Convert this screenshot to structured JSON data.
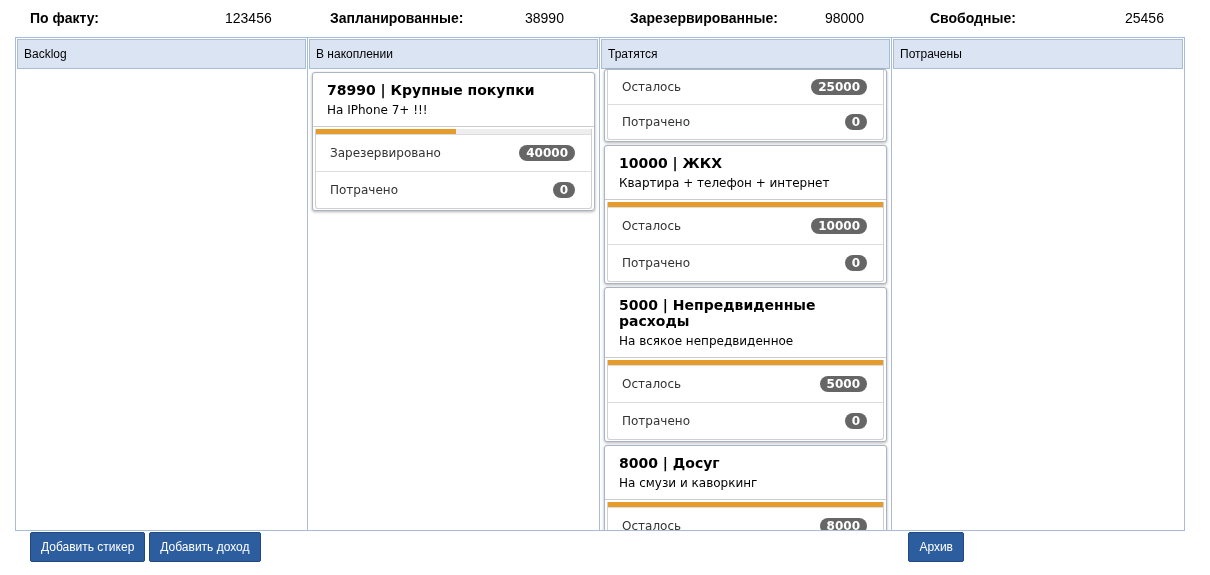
{
  "summary": [
    {
      "label": "По факту:",
      "value": "123456"
    },
    {
      "label": "Запланированные:",
      "value": "38990"
    },
    {
      "label": "Зарезервированные:",
      "value": "98000"
    },
    {
      "label": "Свободные:",
      "value": "25456"
    }
  ],
  "columns": [
    {
      "title": "Backlog"
    },
    {
      "title": "В накоплении",
      "cards": [
        {
          "title": "78990 | Крупные покупки",
          "description": "На IPhone 7+ !!!",
          "level": 0.51,
          "rows": [
            {
              "label": "Зарезервировано",
              "value": "40000"
            },
            {
              "label": "Потрачено",
              "value": "0"
            }
          ]
        }
      ]
    },
    {
      "title": "Тратятся",
      "cards": [
        {
          "rows": [
            {
              "label": "Осталось",
              "value": "25000"
            },
            {
              "label": "Потрачено",
              "value": "0"
            }
          ]
        },
        {
          "title": "10000 | ЖКХ",
          "description": "Квартира + телефон + интернет",
          "level": 1,
          "rows": [
            {
              "label": "Осталось",
              "value": "10000"
            },
            {
              "label": "Потрачено",
              "value": "0"
            }
          ]
        },
        {
          "title": "5000 | Непредвиденные расходы",
          "description": "На всякое непредвиденное",
          "level": 1,
          "rows": [
            {
              "label": "Осталось",
              "value": "5000"
            },
            {
              "label": "Потрачено",
              "value": "0"
            }
          ]
        },
        {
          "title": "8000 | Досуг",
          "description": "На смузи и каворкинг",
          "level": 1,
          "rows": [
            {
              "label": "Осталось",
              "value": "8000"
            }
          ]
        }
      ]
    },
    {
      "title": "Потрачены"
    }
  ],
  "buttons_left": [
    "Добавить стикер",
    "Добавить доход"
  ],
  "buttons_right": [
    "Архив"
  ]
}
